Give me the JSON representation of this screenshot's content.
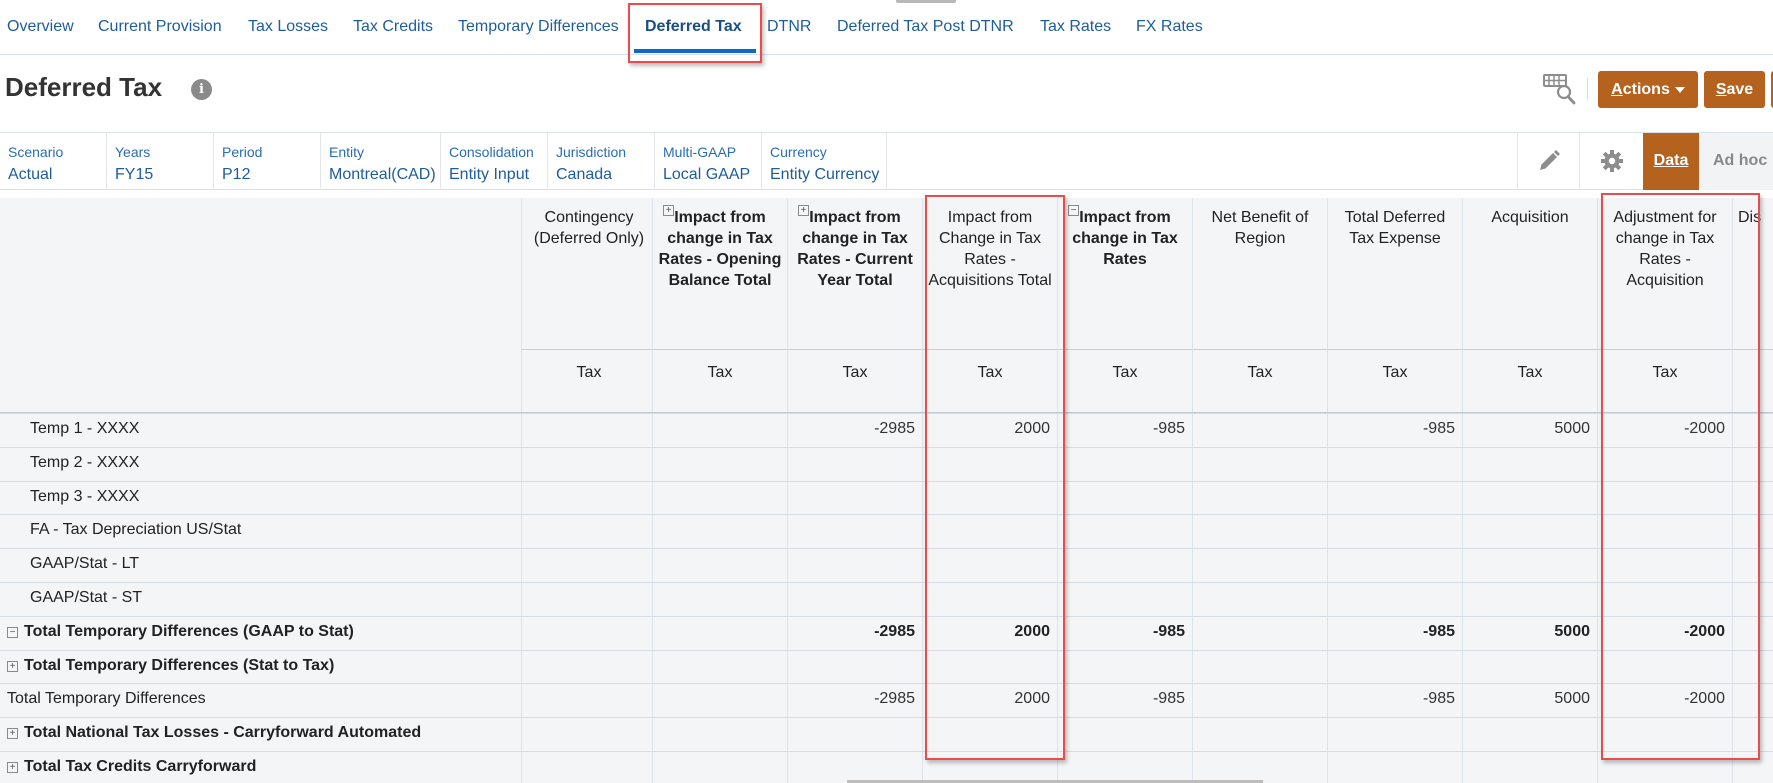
{
  "nav": {
    "tabs": [
      {
        "label": "Overview",
        "active": false
      },
      {
        "label": "Current Provision",
        "active": false
      },
      {
        "label": "Tax Losses",
        "active": false
      },
      {
        "label": "Tax Credits",
        "active": false
      },
      {
        "label": "Temporary Differences",
        "active": false
      },
      {
        "label": "Deferred Tax",
        "active": true
      },
      {
        "label": "DTNR",
        "active": false
      },
      {
        "label": "Deferred Tax Post DTNR",
        "active": false
      },
      {
        "label": "Tax Rates",
        "active": false
      },
      {
        "label": "FX Rates",
        "active": false
      }
    ]
  },
  "header": {
    "title": "Deferred Tax",
    "info_icon": "i",
    "actions_label_ul": "A",
    "actions_label_rest": "ctions",
    "save_label_ul": "S",
    "save_label_rest": "ave"
  },
  "pov": [
    {
      "label": "Scenario",
      "value": "Actual"
    },
    {
      "label": "Years",
      "value": "FY15"
    },
    {
      "label": "Period",
      "value": "P12"
    },
    {
      "label": "Entity",
      "value": "Montreal(CAD)"
    },
    {
      "label": "Consolidation",
      "value": "Entity Input"
    },
    {
      "label": "Jurisdiction",
      "value": "Canada"
    },
    {
      "label": "Multi-GAAP",
      "value": "Local GAAP"
    },
    {
      "label": "Currency",
      "value": "Entity Currency"
    }
  ],
  "view_tabs": {
    "data": "Data",
    "adhoc": "Ad hoc"
  },
  "grid": {
    "columns": [
      {
        "label": "Contingency (Deferred Only)",
        "sub": "Tax",
        "bold": false,
        "expander": ""
      },
      {
        "label": "Impact from change in Tax Rates - Opening Balance Total",
        "sub": "Tax",
        "bold": true,
        "expander": "+"
      },
      {
        "label": "Impact from change in Tax Rates - Current Year Total",
        "sub": "Tax",
        "bold": true,
        "expander": "+"
      },
      {
        "label": "Impact from Change in Tax Rates - Acquisitions Total",
        "sub": "Tax",
        "bold": false,
        "expander": ""
      },
      {
        "label": "Impact from change in Tax Rates",
        "sub": "Tax",
        "bold": true,
        "expander": "−"
      },
      {
        "label": "Net Benefit of Region",
        "sub": "Tax",
        "bold": false,
        "expander": ""
      },
      {
        "label": "Total Deferred Tax Expense",
        "sub": "Tax",
        "bold": false,
        "expander": ""
      },
      {
        "label": "Acquisition",
        "sub": "Tax",
        "bold": false,
        "expander": ""
      },
      {
        "label": "Adjustment for change in Tax Rates - Acquisition",
        "sub": "Tax",
        "bold": false,
        "expander": ""
      },
      {
        "label": "Dis",
        "sub": "",
        "bold": false,
        "expander": ""
      }
    ],
    "rows": [
      {
        "label": "Temp 1 - XXXX",
        "style": "indent",
        "expander": "",
        "values": [
          "",
          "",
          "-2985",
          "2000",
          "-985",
          "",
          "-985",
          "5000",
          "-2000",
          ""
        ]
      },
      {
        "label": "Temp 2 - XXXX",
        "style": "indent",
        "expander": "",
        "values": [
          "",
          "",
          "",
          "",
          "",
          "",
          "",
          "",
          "",
          ""
        ]
      },
      {
        "label": "Temp 3 - XXXX",
        "style": "indent",
        "expander": "",
        "values": [
          "",
          "",
          "",
          "",
          "",
          "",
          "",
          "",
          "",
          ""
        ]
      },
      {
        "label": "FA - Tax Depreciation US/Stat",
        "style": "indent",
        "expander": "",
        "values": [
          "",
          "",
          "",
          "",
          "",
          "",
          "",
          "",
          "",
          ""
        ]
      },
      {
        "label": "GAAP/Stat - LT",
        "style": "indent",
        "expander": "",
        "values": [
          "",
          "",
          "",
          "",
          "",
          "",
          "",
          "",
          "",
          ""
        ]
      },
      {
        "label": "GAAP/Stat - ST",
        "style": "indent",
        "expander": "",
        "values": [
          "",
          "",
          "",
          "",
          "",
          "",
          "",
          "",
          "",
          ""
        ]
      },
      {
        "label": "Total Temporary Differences (GAAP to Stat)",
        "style": "bold",
        "expander": "−",
        "values": [
          "",
          "",
          "-2985",
          "2000",
          "-985",
          "",
          "-985",
          "5000",
          "-2000",
          ""
        ]
      },
      {
        "label": "Total Temporary Differences (Stat to Tax)",
        "style": "bold",
        "expander": "+",
        "values": [
          "",
          "",
          "",
          "",
          "",
          "",
          "",
          "",
          "",
          ""
        ]
      },
      {
        "label": "Total Temporary Differences",
        "style": "plain",
        "expander": "",
        "values": [
          "",
          "",
          "-2985",
          "2000",
          "-985",
          "",
          "-985",
          "5000",
          "-2000",
          ""
        ]
      },
      {
        "label": "Total National Tax Losses - Carryforward Automated",
        "style": "bold",
        "expander": "+",
        "values": [
          "",
          "",
          "",
          "",
          "",
          "",
          "",
          "",
          "",
          ""
        ]
      },
      {
        "label": "Total Tax Credits Carryforward",
        "style": "bold",
        "expander": "+",
        "values": [
          "",
          "",
          "",
          "",
          "",
          "",
          "",
          "",
          "",
          ""
        ]
      }
    ]
  },
  "colors": {
    "accent_orange": "#b5621f",
    "link_blue": "#1f5d99",
    "active_tab_underline": "#0b6bc7",
    "highlight_red": "#ec4b4b"
  }
}
